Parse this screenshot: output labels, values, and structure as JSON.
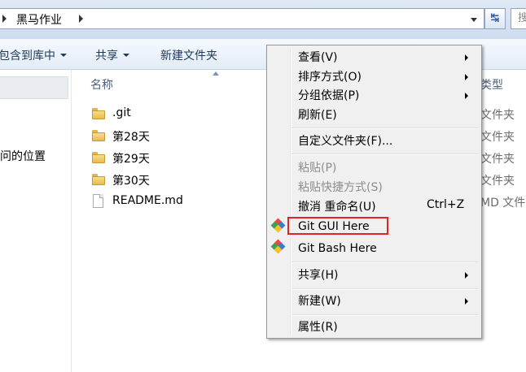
{
  "address": {
    "breadcrumb": "黑马作业",
    "search_placeholder": "搜"
  },
  "toolbar": {
    "include_library_label": "包含到库中",
    "share_label": "共享",
    "new_folder_label": "新建文件夹"
  },
  "nav_pane": {
    "recent_places_label": "问的位置"
  },
  "file_list": {
    "col_name": "名称",
    "col_type": "类型",
    "files": [
      {
        "name": ".git",
        "icon": "folder-icon",
        "type": "文件夹"
      },
      {
        "name": "第28天",
        "icon": "folder-icon",
        "type": "文件夹"
      },
      {
        "name": "第29天",
        "icon": "folder-icon",
        "type": "文件夹"
      },
      {
        "name": "第30天",
        "icon": "folder-icon",
        "type": "文件夹"
      },
      {
        "name": "README.md",
        "icon": "document-icon",
        "type": "MD 文件"
      }
    ]
  },
  "context_menu": {
    "view": "查看(V)",
    "sort_by": "排序方式(O)",
    "group_by": "分组依据(P)",
    "refresh": "刷新(E)",
    "customize_folder": "自定义文件夹(F)...",
    "paste": "粘贴(P)",
    "paste_shortcut": "粘贴快捷方式(S)",
    "undo_rename": "撤消 重命名(U)",
    "undo_shortcut": "Ctrl+Z",
    "git_gui": "Git GUI Here",
    "git_bash": "Git Bash Here",
    "share": "共享(H)",
    "new": "新建(W)",
    "properties": "属性(R)"
  },
  "colors": {
    "highlight_border": "#e2232a",
    "toolbar_text": "#1e395b"
  }
}
